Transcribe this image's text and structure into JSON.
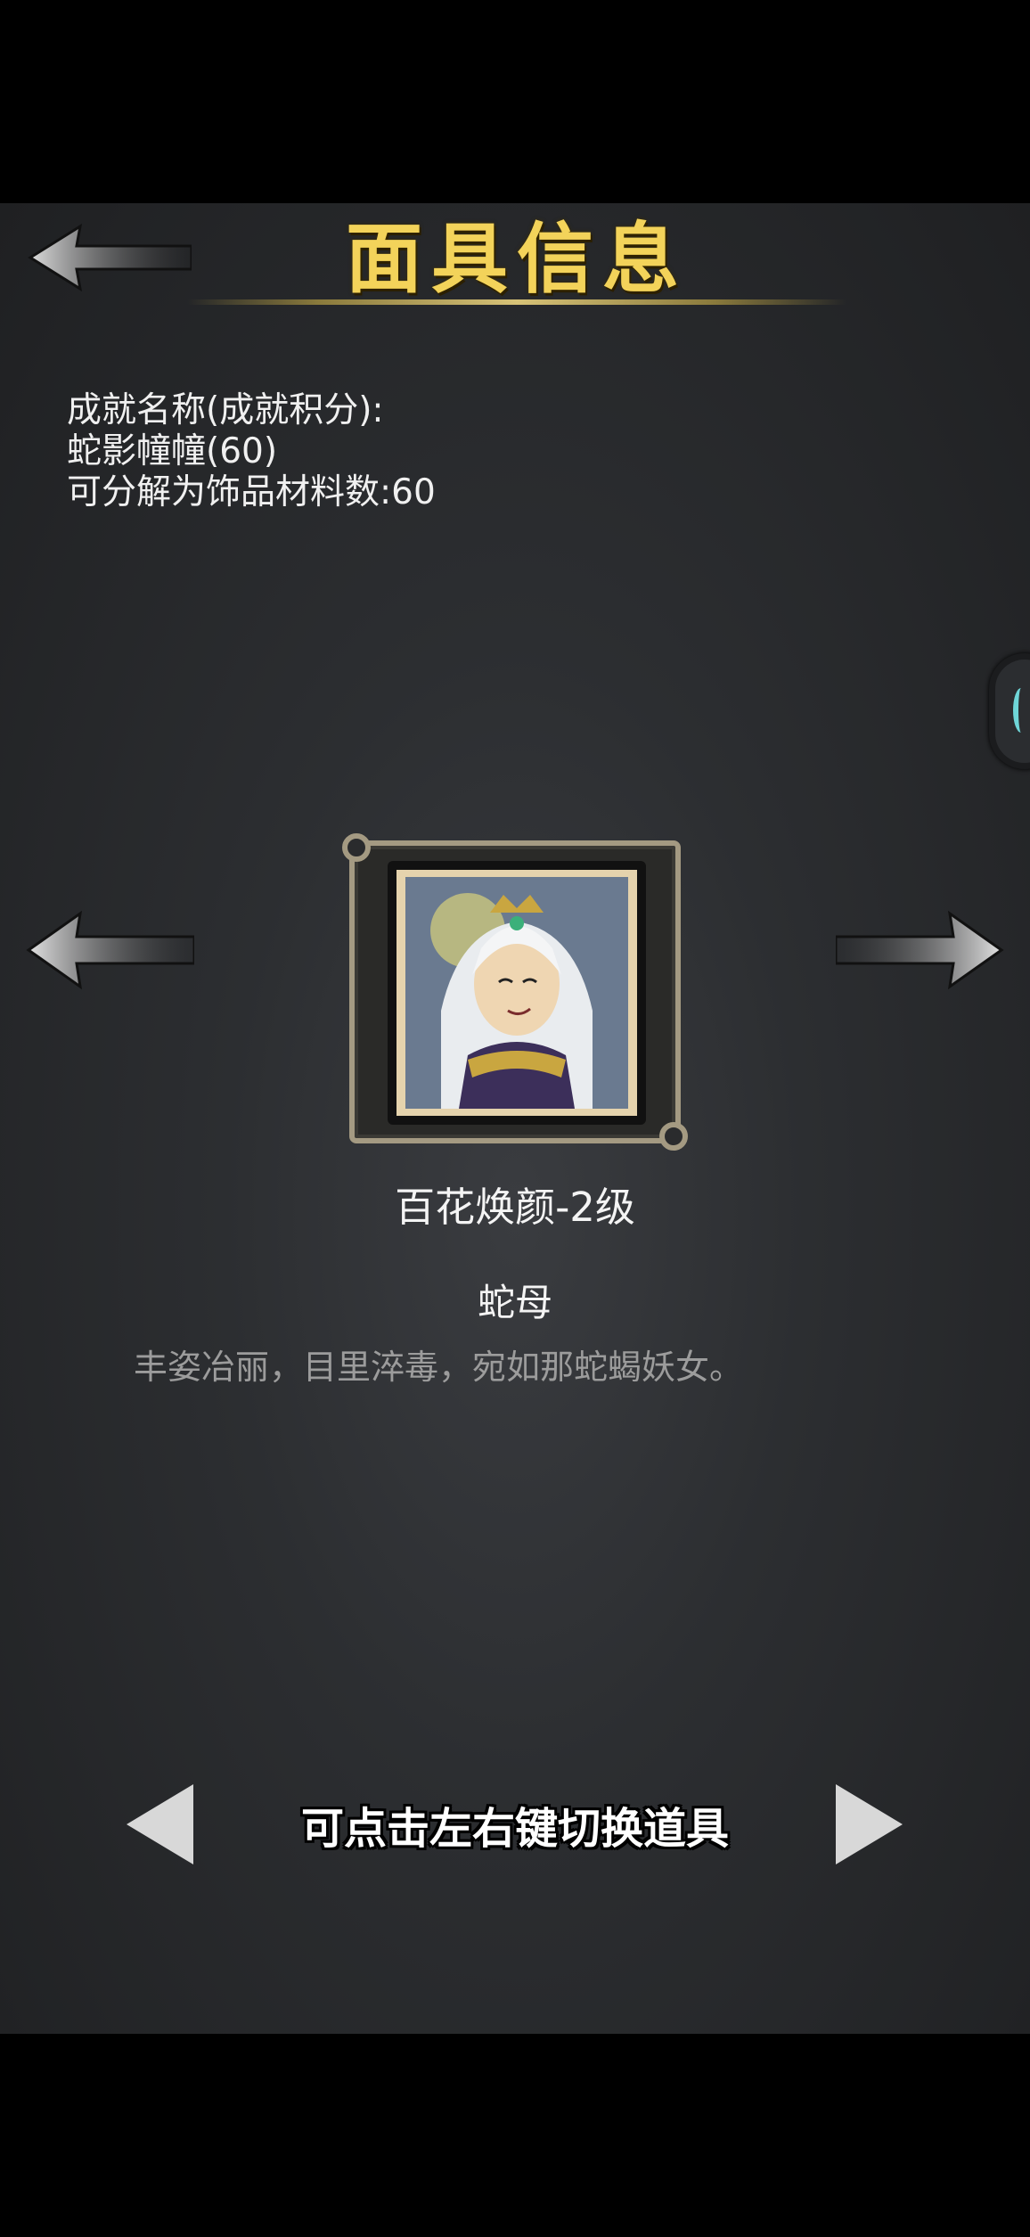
{
  "header": {
    "title": "面具信息"
  },
  "info": {
    "line1": "成就名称(成就积分):",
    "line2": "蛇影幢幢(60)",
    "line3": "可分解为饰品材料数:60"
  },
  "mask": {
    "name": "百花焕颜-2级",
    "subtitle": "蛇母",
    "description": "丰姿冶丽，目里淬毒，宛如那蛇蝎妖女。"
  },
  "footer": {
    "hint": "可点击左右键切换道具"
  },
  "colors": {
    "title": "#f3d35a",
    "frame": "#a49a82",
    "accent": "#6fd6d8"
  }
}
